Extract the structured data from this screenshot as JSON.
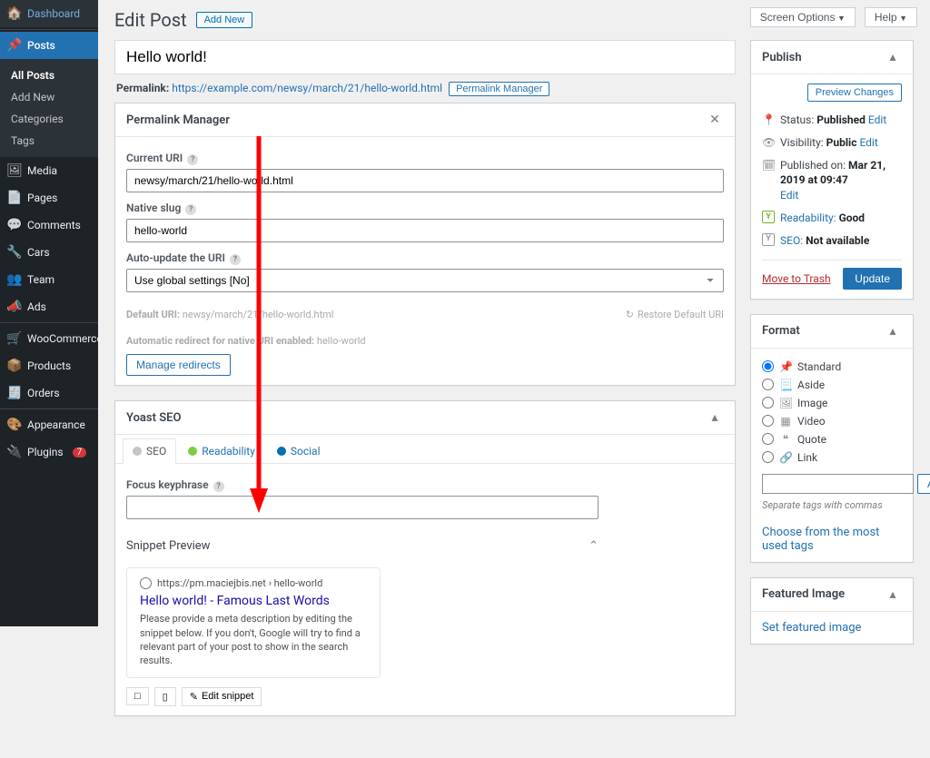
{
  "topbar": {
    "screen_options": "Screen Options",
    "help": "Help"
  },
  "sidebar": {
    "items": [
      {
        "icon": "🏠",
        "label": "Dashboard"
      },
      {
        "icon": "📌",
        "label": "Posts",
        "active": true
      },
      {
        "icon": "🖼",
        "label": "Media"
      },
      {
        "icon": "📄",
        "label": "Pages"
      },
      {
        "icon": "💬",
        "label": "Comments"
      },
      {
        "icon": "🔧",
        "label": "Cars"
      },
      {
        "icon": "👥",
        "label": "Team"
      },
      {
        "icon": "📣",
        "label": "Ads"
      },
      {
        "icon": "🛒",
        "label": "WooCommerce"
      },
      {
        "icon": "📦",
        "label": "Products"
      },
      {
        "icon": "🧾",
        "label": "Orders"
      },
      {
        "icon": "🎨",
        "label": "Appearance"
      },
      {
        "icon": "🔌",
        "label": "Plugins",
        "badge": "7"
      }
    ],
    "sub": [
      {
        "label": "All Posts",
        "active": true
      },
      {
        "label": "Add New"
      },
      {
        "label": "Categories"
      },
      {
        "label": "Tags"
      }
    ]
  },
  "header": {
    "title": "Edit Post",
    "add_new": "Add New"
  },
  "post": {
    "title": "Hello world!",
    "permalink_label": "Permalink:",
    "permalink": "https://example.com/newsy/march/21/hello-world.html",
    "permalink_manager_btn": "Permalink Manager"
  },
  "pm": {
    "title": "Permalink Manager",
    "current_uri_label": "Current URI",
    "current_uri": "newsy/march/21/hello-world.html",
    "native_slug_label": "Native slug",
    "native_slug": "hello-world",
    "auto_update_label": "Auto-update the URI",
    "auto_update_value": "Use global settings [No]",
    "default_uri_label": "Default URI:",
    "default_uri": "newsy/march/21/hello-world.html",
    "restore": "Restore Default URI",
    "auto_redirect_label": "Automatic redirect for native URI enabled:",
    "auto_redirect_value": "hello-world",
    "manage_btn": "Manage redirects"
  },
  "yoast": {
    "title": "Yoast SEO",
    "tab_seo": "SEO",
    "tab_readability": "Readability",
    "tab_social": "Social",
    "focus_label": "Focus keyphrase",
    "snippet_label": "Snippet Preview",
    "snippet_crumb": "https://pm.maciejbis.net › hello-world",
    "snippet_title": "Hello world! - Famous Last Words",
    "snippet_desc": "Please provide a meta description by editing the snippet below. If you don't, Google will try to find a relevant part of your post to show in the search results.",
    "edit_snippet": "Edit snippet"
  },
  "publish": {
    "title": "Publish",
    "preview": "Preview Changes",
    "status_label": "Status:",
    "status_value": "Published",
    "visibility_label": "Visibility:",
    "visibility_value": "Public",
    "published_label": "Published on:",
    "published_value": "Mar 21, 2019 at 09:47",
    "readability_label": "Readability:",
    "readability_value": "Good",
    "seo_label": "SEO:",
    "seo_value": "Not available",
    "edit": "Edit",
    "trash": "Move to Trash",
    "update": "Update"
  },
  "format": {
    "title": "Format",
    "options": [
      {
        "label": "Standard",
        "icon": "📌",
        "checked": true
      },
      {
        "label": "Aside",
        "icon": "📃"
      },
      {
        "label": "Image",
        "icon": "🖼"
      },
      {
        "label": "Video",
        "icon": "▦"
      },
      {
        "label": "Quote",
        "icon": "❝"
      },
      {
        "label": "Link",
        "icon": "🔗"
      }
    ],
    "add": "Add",
    "hint": "Separate tags with commas",
    "choose": "Choose from the most used tags"
  },
  "featured": {
    "title": "Featured Image",
    "set": "Set featured image"
  }
}
